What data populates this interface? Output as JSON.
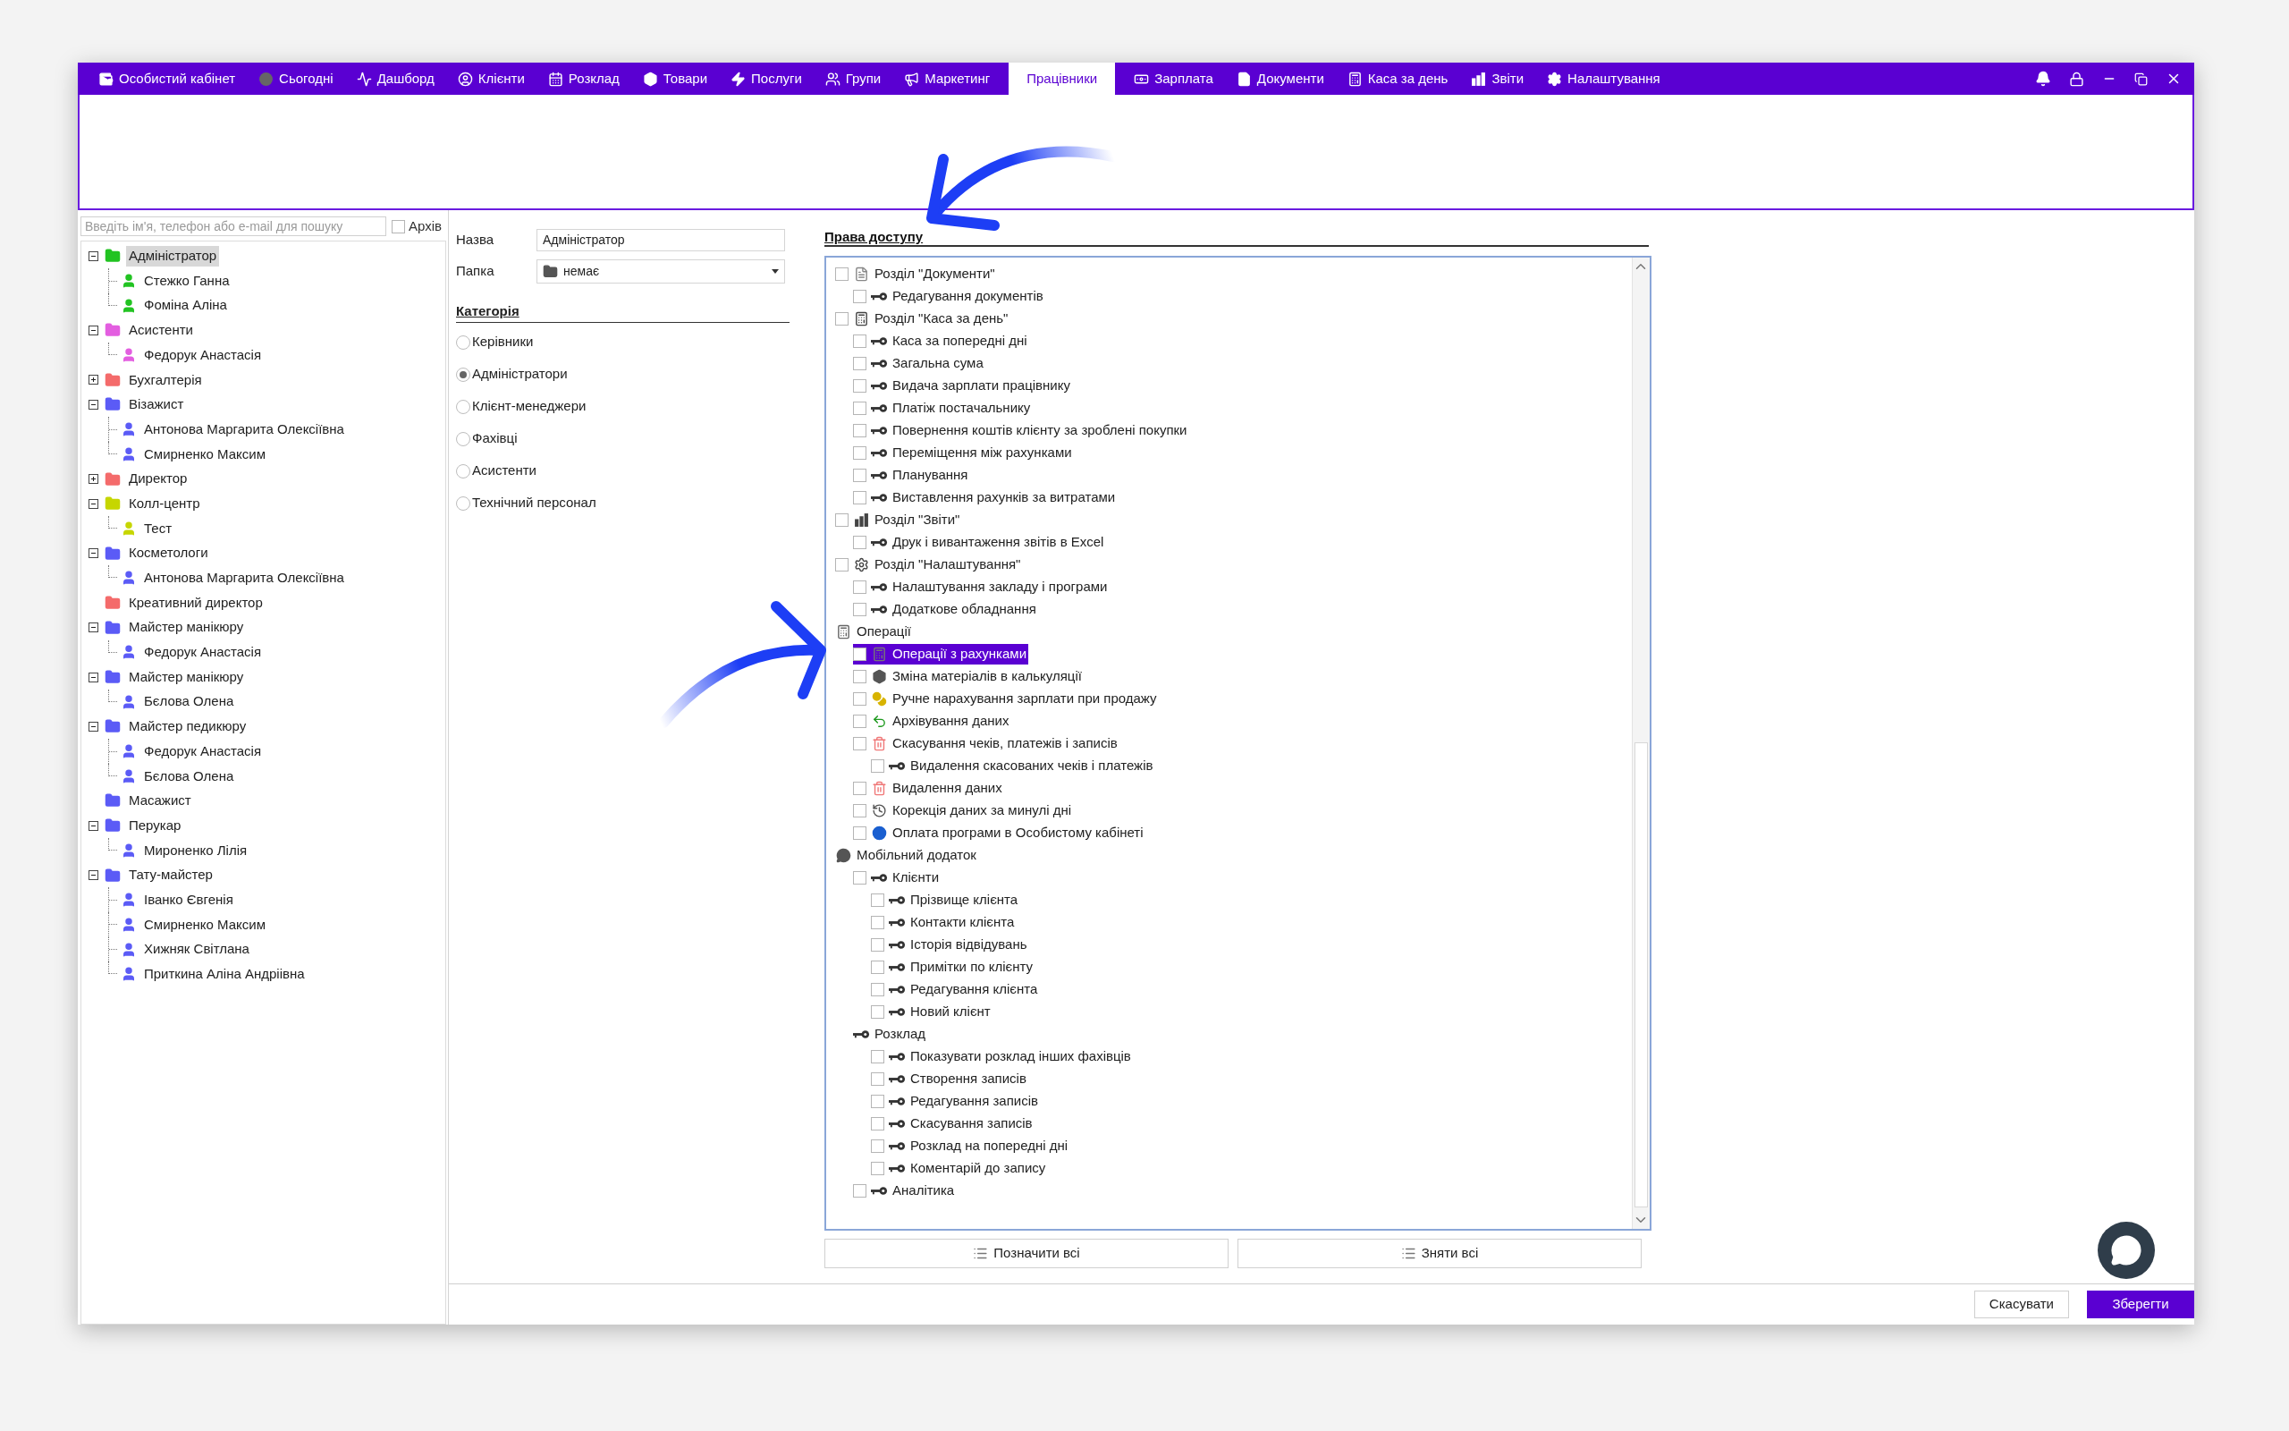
{
  "nav": {
    "tabs": [
      {
        "label": "Особистий кабінет",
        "selected": false
      },
      {
        "label": "Сьогодні",
        "selected": false
      },
      {
        "label": "Дашборд",
        "selected": false
      },
      {
        "label": "Клієнти",
        "selected": false
      },
      {
        "label": "Розклад",
        "selected": false
      },
      {
        "label": "Товари",
        "selected": false
      },
      {
        "label": "Послуги",
        "selected": false
      },
      {
        "label": "Групи",
        "selected": false
      },
      {
        "label": "Маркетинг",
        "selected": false
      },
      {
        "label": "Працівники",
        "selected": true
      },
      {
        "label": "Зарплата",
        "selected": false
      },
      {
        "label": "Документи",
        "selected": false
      },
      {
        "label": "Каса за день",
        "selected": false
      },
      {
        "label": "Звіти",
        "selected": false
      },
      {
        "label": "Налаштування",
        "selected": false
      }
    ]
  },
  "staff": {
    "search": {
      "placeholder": "Введіть ім'я, телефон або e-mail для пошуку"
    },
    "archive": {
      "label": "Архів",
      "checked": false
    },
    "groups": [
      {
        "label": "Адміністратор",
        "color": "#22c322",
        "expanded": true,
        "selected": true,
        "children": [
          {
            "label": "Стежко Ганна",
            "selected": false
          },
          {
            "label": "Фоміна Аліна",
            "selected": false
          }
        ]
      },
      {
        "label": "Асистенти",
        "color": "#e35ee0",
        "expanded": true,
        "selected": false,
        "children": [
          {
            "label": "Федорук Анастасія",
            "selected": false
          }
        ]
      },
      {
        "label": "Бухгалтерія",
        "color": "#f46b6b",
        "expanded": false,
        "selected": false
      },
      {
        "label": "Візажист",
        "color": "#5b5bf6",
        "expanded": true,
        "selected": false,
        "children": [
          {
            "label": "Антонова Маргарита Олексіївна",
            "selected": false
          },
          {
            "label": "Смирненко Максим",
            "selected": false
          }
        ]
      },
      {
        "label": "Директор",
        "color": "#f46b6b",
        "expanded": false,
        "selected": false
      },
      {
        "label": "Колл-центр",
        "color": "#c6d600",
        "expanded": true,
        "selected": false,
        "children": [
          {
            "label": "Тест",
            "selected": false
          }
        ]
      },
      {
        "label": "Косметологи",
        "color": "#5b5bf6",
        "expanded": true,
        "selected": false,
        "children": [
          {
            "label": "Антонова Маргарита Олексіївна",
            "selected": false
          }
        ]
      },
      {
        "label": "Креативний директор",
        "color": "#f46b6b",
        "selected": false
      },
      {
        "label": "Майстер манікюру",
        "color": "#5b5bf6",
        "expanded": true,
        "selected": false,
        "children": [
          {
            "label": "Федорук Анастасія",
            "selected": false
          }
        ]
      },
      {
        "label": "Майстер манікюру",
        "color": "#5b5bf6",
        "expanded": true,
        "selected": false,
        "children": [
          {
            "label": "Бєлова Олена",
            "selected": false
          }
        ]
      },
      {
        "label": "Майстер педикюру",
        "color": "#5b5bf6",
        "expanded": true,
        "selected": false,
        "children": [
          {
            "label": "Федорук Анастасія",
            "selected": false
          },
          {
            "label": "Бєлова Олена",
            "selected": false
          }
        ]
      },
      {
        "label": "Масажист",
        "color": "#5b5bf6",
        "selected": false
      },
      {
        "label": "Перукар",
        "color": "#5b5bf6",
        "expanded": true,
        "selected": false,
        "children": [
          {
            "label": "Мироненко Лілія",
            "selected": false
          }
        ]
      },
      {
        "label": "Тату-майстер",
        "color": "#5b5bf6",
        "expanded": true,
        "selected": false,
        "children": [
          {
            "label": "Іванко Євгенія",
            "selected": false
          },
          {
            "label": "Смирненко Максим",
            "selected": false
          },
          {
            "label": "Хижняк Світлана",
            "selected": false
          },
          {
            "label": "Приткина Аліна Андріівна",
            "selected": false
          }
        ]
      }
    ]
  },
  "form": {
    "name": {
      "label": "Назва",
      "value": "Адміністратор"
    },
    "folder": {
      "label": "Папка",
      "value": "немає"
    },
    "category": {
      "title": "Категорія",
      "options": [
        {
          "label": "Керівники",
          "selected": false
        },
        {
          "label": "Адміністратори",
          "selected": true
        },
        {
          "label": "Клієнт-менеджери",
          "selected": false
        },
        {
          "label": "Фахівці",
          "selected": false
        },
        {
          "label": "Асистенти",
          "selected": false
        },
        {
          "label": "Технічний персонал",
          "selected": false
        }
      ]
    }
  },
  "permissions": {
    "title": "Права доступу",
    "items": [
      {
        "label": "Розділ \"Документи\"",
        "checked": false,
        "selected": false,
        "children": [
          {
            "label": "Редагування документів",
            "checked": false,
            "selected": false
          }
        ]
      },
      {
        "label": "Розділ \"Каса за день\"",
        "checked": false,
        "selected": false,
        "children": [
          {
            "label": "Каса за попередні дні",
            "checked": false,
            "selected": false
          },
          {
            "label": "Загальна сума",
            "checked": false,
            "selected": false
          },
          {
            "label": "Видача зарплати працівнику",
            "checked": false,
            "selected": false
          },
          {
            "label": "Платіж постачальнику",
            "checked": false,
            "selected": false
          },
          {
            "label": "Повернення коштів клієнту за зроблені покупки",
            "checked": false,
            "selected": false
          },
          {
            "label": "Переміщення між рахунками",
            "checked": false,
            "selected": false
          },
          {
            "label": "Планування",
            "checked": false,
            "selected": false
          },
          {
            "label": "Виставлення рахунків за витратами",
            "checked": false,
            "selected": false
          }
        ]
      },
      {
        "label": "Розділ \"Звіти\"",
        "checked": false,
        "selected": false,
        "children": [
          {
            "label": "Друк і вивантаження звітів в Excel",
            "checked": false,
            "selected": false
          }
        ]
      },
      {
        "label": "Розділ \"Налаштування\"",
        "checked": false,
        "selected": false,
        "children": [
          {
            "label": "Налаштування закладу і програми",
            "checked": false,
            "selected": false
          },
          {
            "label": "Додаткове обладнання",
            "checked": false,
            "selected": false
          }
        ]
      },
      {
        "label": "Операції",
        "selected": false,
        "children": [
          {
            "label": "Операції з рахунками",
            "checked": false,
            "selected": true
          },
          {
            "label": "Зміна матеріалів в калькуляції",
            "checked": false,
            "selected": false
          },
          {
            "label": "Ручне нарахування зарплати при продажу",
            "checked": false,
            "selected": false
          },
          {
            "label": "Архівування даних",
            "checked": false,
            "selected": false
          },
          {
            "label": "Скасування чеків, платежів і записів",
            "checked": false,
            "selected": false,
            "children": [
              {
                "label": "Видалення скасованих чеків і платежів",
                "checked": false,
                "selected": false
              }
            ]
          },
          {
            "label": "Видалення даних",
            "checked": false,
            "selected": false
          },
          {
            "label": "Корекція даних за минулі дні",
            "checked": false,
            "selected": false
          },
          {
            "label": "Оплата програми в Особистому кабінеті",
            "checked": false,
            "selected": false
          }
        ]
      },
      {
        "label": "Мобільний додаток",
        "selected": false,
        "children": [
          {
            "label": "Клієнти",
            "checked": false,
            "selected": false,
            "children": [
              {
                "label": "Прізвище клієнта",
                "checked": false,
                "selected": false
              },
              {
                "label": "Контакти клієнта",
                "checked": false,
                "selected": false
              },
              {
                "label": "Історія відвідувань",
                "checked": false,
                "selected": false
              },
              {
                "label": "Примітки по клієнту",
                "checked": false,
                "selected": false
              },
              {
                "label": "Редагування клієнта",
                "checked": false,
                "selected": false
              },
              {
                "label": "Новий клієнт",
                "checked": false,
                "selected": false
              }
            ]
          },
          {
            "label": "Розклад",
            "selected": false,
            "children": [
              {
                "label": "Показувати розклад інших фахівців",
                "checked": false,
                "selected": false
              },
              {
                "label": "Створення записів",
                "checked": false,
                "selected": false
              },
              {
                "label": "Редагування записів",
                "checked": false,
                "selected": false
              },
              {
                "label": "Скасування записів",
                "checked": false,
                "selected": false
              },
              {
                "label": "Розклад на попередні дні",
                "checked": false,
                "selected": false
              },
              {
                "label": "Коментарій до запису",
                "checked": false,
                "selected": false
              }
            ]
          },
          {
            "label": "Аналітика",
            "checked": false,
            "selected": false
          }
        ]
      }
    ],
    "buttons": [
      "Позначити всі",
      "Зняти всі"
    ]
  },
  "footer": {
    "buttons": [
      "Скасувати",
      "Зберегти"
    ]
  }
}
